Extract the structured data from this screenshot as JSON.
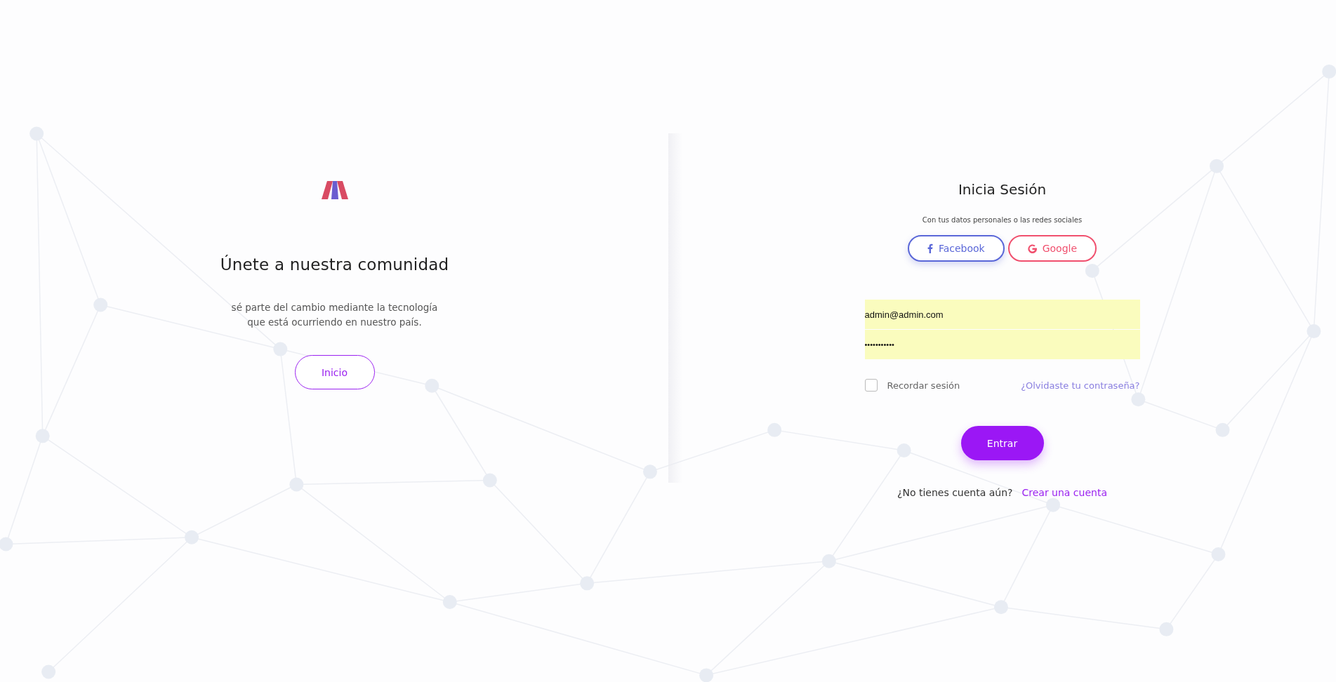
{
  "welcome": {
    "heading": "Únete a nuestra comunidad",
    "text_lines": [
      "sé parte del cambio mediante la tecnología",
      "que está ocurriendo en nuestro país."
    ],
    "button": "Inicio"
  },
  "login": {
    "title": "Inicia Sesión",
    "subtitle": "Con tus datos personales o las redes sociales",
    "social_buttons": [
      {
        "kind": "facebook",
        "label": "Facebook",
        "color": "#5a67d8"
      },
      {
        "kind": "google",
        "label": "Google",
        "color": "#f0506e"
      }
    ],
    "fields": [
      {
        "kind": "email",
        "value": "admin@admin.com"
      },
      {
        "kind": "password",
        "value": "•••••••••••"
      }
    ],
    "remember": {
      "label": "Recordar sesión",
      "checked": false
    },
    "forgot_link": "¿Olvidaste tu contraseña?",
    "submit": "Entrar",
    "footer": {
      "text": "¿No tienes cuenta aún?",
      "link": "Crear una cuenta"
    }
  }
}
